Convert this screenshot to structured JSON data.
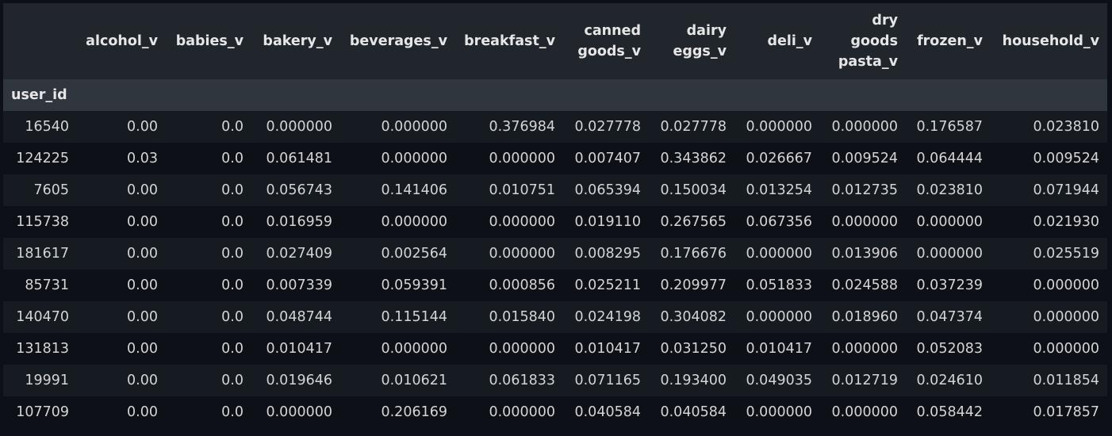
{
  "table": {
    "index_name": "user_id",
    "columns": [
      [
        "alcohol_v"
      ],
      [
        "babies_v"
      ],
      [
        "bakery_v"
      ],
      [
        "beverages_v"
      ],
      [
        "breakfast_v"
      ],
      [
        "canned",
        "goods_v"
      ],
      [
        "dairy",
        "eggs_v"
      ],
      [
        "deli_v"
      ],
      [
        "dry",
        "goods",
        "pasta_v"
      ],
      [
        "frozen_v"
      ],
      [
        "household_v"
      ]
    ],
    "rows": [
      {
        "index": "16540",
        "values": [
          "0.00",
          "0.0",
          "0.000000",
          "0.000000",
          "0.376984",
          "0.027778",
          "0.027778",
          "0.000000",
          "0.000000",
          "0.176587",
          "0.023810"
        ]
      },
      {
        "index": "124225",
        "values": [
          "0.03",
          "0.0",
          "0.061481",
          "0.000000",
          "0.000000",
          "0.007407",
          "0.343862",
          "0.026667",
          "0.009524",
          "0.064444",
          "0.009524"
        ]
      },
      {
        "index": "7605",
        "values": [
          "0.00",
          "0.0",
          "0.056743",
          "0.141406",
          "0.010751",
          "0.065394",
          "0.150034",
          "0.013254",
          "0.012735",
          "0.023810",
          "0.071944"
        ]
      },
      {
        "index": "115738",
        "values": [
          "0.00",
          "0.0",
          "0.016959",
          "0.000000",
          "0.000000",
          "0.019110",
          "0.267565",
          "0.067356",
          "0.000000",
          "0.000000",
          "0.021930"
        ]
      },
      {
        "index": "181617",
        "values": [
          "0.00",
          "0.0",
          "0.027409",
          "0.002564",
          "0.000000",
          "0.008295",
          "0.176676",
          "0.000000",
          "0.013906",
          "0.000000",
          "0.025519"
        ]
      },
      {
        "index": "85731",
        "values": [
          "0.00",
          "0.0",
          "0.007339",
          "0.059391",
          "0.000856",
          "0.025211",
          "0.209977",
          "0.051833",
          "0.024588",
          "0.037239",
          "0.000000"
        ]
      },
      {
        "index": "140470",
        "values": [
          "0.00",
          "0.0",
          "0.048744",
          "0.115144",
          "0.015840",
          "0.024198",
          "0.304082",
          "0.000000",
          "0.018960",
          "0.047374",
          "0.000000"
        ]
      },
      {
        "index": "131813",
        "values": [
          "0.00",
          "0.0",
          "0.010417",
          "0.000000",
          "0.000000",
          "0.010417",
          "0.031250",
          "0.010417",
          "0.000000",
          "0.052083",
          "0.000000"
        ]
      },
      {
        "index": "19991",
        "values": [
          "0.00",
          "0.0",
          "0.019646",
          "0.010621",
          "0.061833",
          "0.071165",
          "0.193400",
          "0.049035",
          "0.012719",
          "0.024610",
          "0.011854"
        ]
      },
      {
        "index": "107709",
        "values": [
          "0.00",
          "0.0",
          "0.000000",
          "0.206169",
          "0.000000",
          "0.040584",
          "0.040584",
          "0.000000",
          "0.000000",
          "0.058442",
          "0.017857"
        ]
      }
    ]
  }
}
